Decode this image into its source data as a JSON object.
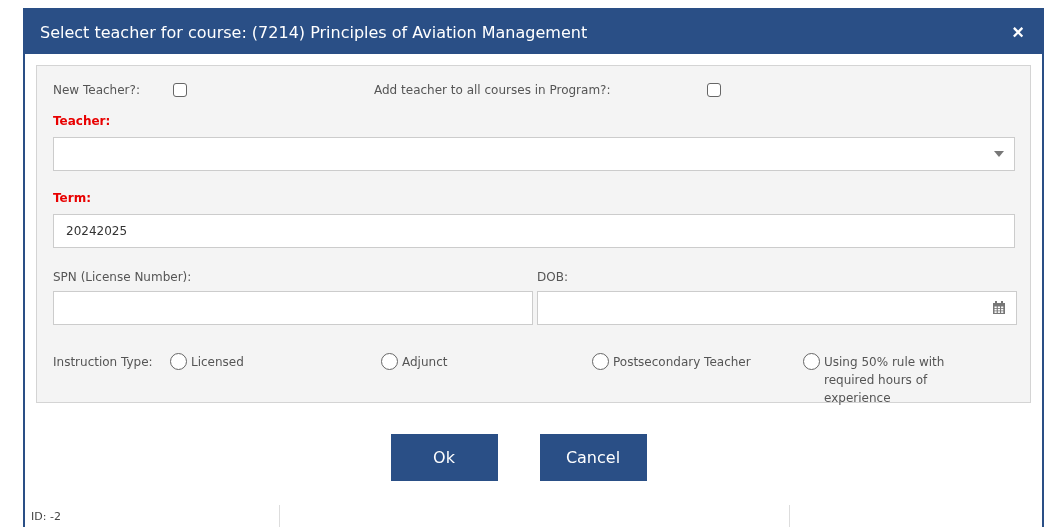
{
  "dialog": {
    "title": "Select teacher for course: (7214) Principles of Aviation Management",
    "close": "×"
  },
  "options": [
    {
      "label": "New Teacher?:",
      "checked": false
    },
    {
      "label": "Add teacher to all courses in Program?:",
      "checked": false
    }
  ],
  "teacher": {
    "label": "Teacher:",
    "required": true
  },
  "term": {
    "label": "Term:",
    "required": true,
    "value": "20242025"
  },
  "spn": {
    "label": "SPN (License Number):"
  },
  "dob": {
    "label": "DOB:"
  },
  "instruction_type": {
    "label": "Instruction Type:",
    "options": [
      {
        "label": "Licensed",
        "selected": false
      },
      {
        "label": "Adjunct",
        "selected": false
      },
      {
        "label": "Postsecondary Teacher",
        "selected": false
      },
      {
        "label": "Using 50% rule with required hours of experience",
        "selected": false
      }
    ]
  },
  "buttons": [
    "Ok",
    "Cancel"
  ],
  "status_bar": {
    "id": "ID: -2"
  }
}
